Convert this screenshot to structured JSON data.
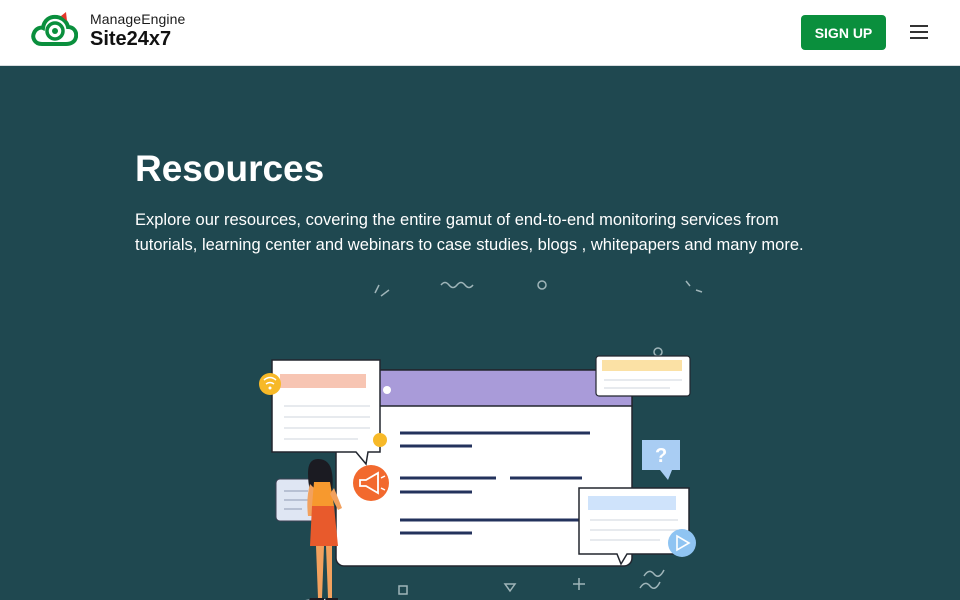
{
  "header": {
    "brand": "ManageEngine",
    "product": "Site24x7",
    "signup_label": "SIGN UP"
  },
  "hero": {
    "title": "Resources",
    "description": "Explore our resources, covering the entire gamut of end-to-end monitoring services from tutorials, learning center and webinars to case studies, blogs , whitepapers and many more."
  },
  "illustration": {
    "question_mark": "?"
  },
  "colors": {
    "header_bg": "#ffffff",
    "hero_bg": "#1f4850",
    "accent_green": "#0a8f3d",
    "window_titlebar": "#a99bd9",
    "orange": "#f2692e",
    "light_blue": "#8fc4f2"
  },
  "icons": [
    "site24x7-logo-icon",
    "hamburger-menu-icon",
    "megaphone-icon",
    "wifi-icon",
    "play-icon",
    "question-icon"
  ]
}
